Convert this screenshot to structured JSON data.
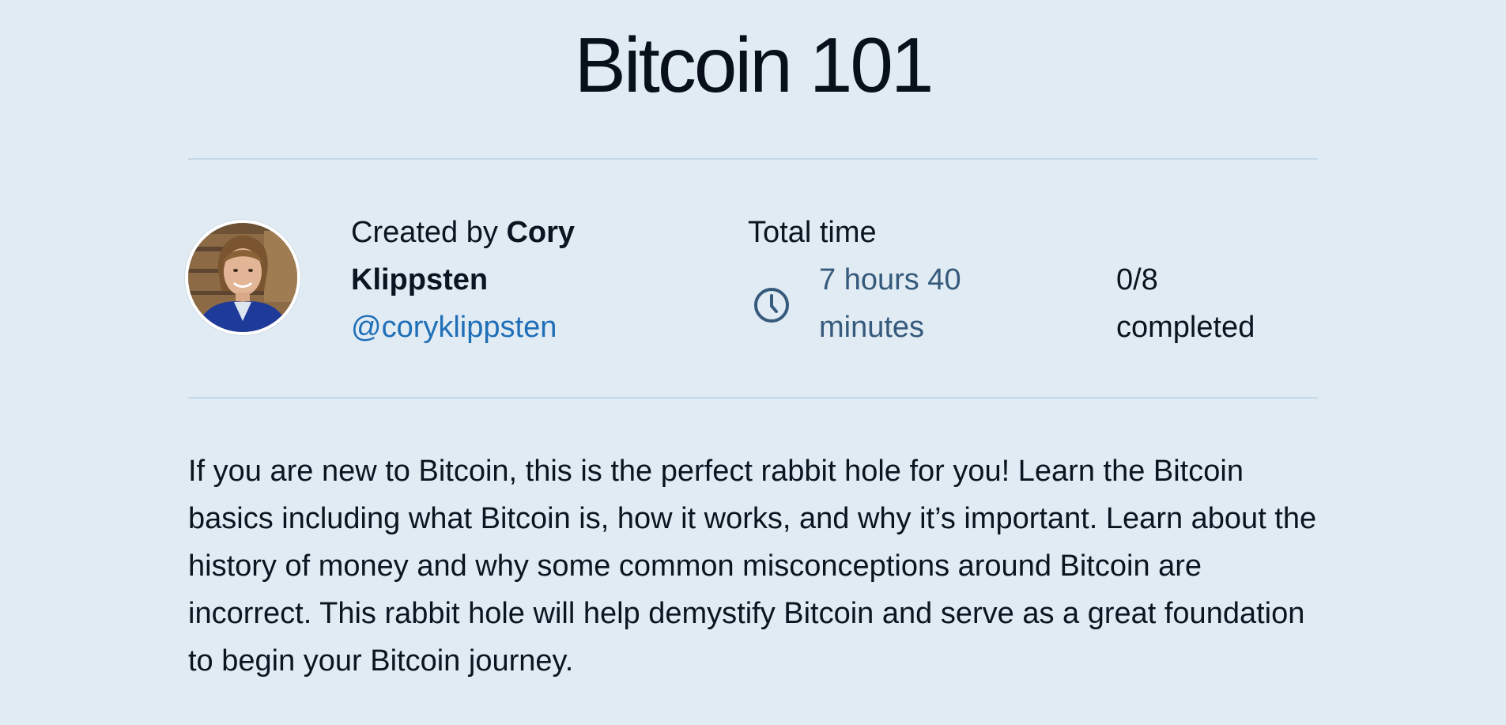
{
  "course": {
    "title": "Bitcoin 101"
  },
  "creator": {
    "prefix": "Created by",
    "first_name": "Cory",
    "last_name": "Klippsten",
    "handle": "@coryklippsten",
    "avatar_icon": "person-photo"
  },
  "time": {
    "label": "Total time",
    "value_line1": "7 hours 40",
    "value_line2": "minutes",
    "icon": "clock-icon"
  },
  "progress": {
    "count": "0/8",
    "label": "completed",
    "completed_fraction": 0
  },
  "description": "If you are new to Bitcoin, this is the perfect rabbit hole for you! Learn the Bitcoin basics including what Bitcoin is, how it works, and why it’s important. Learn about the history of money and why some common misconceptions around Bitcoin are incorrect. This rabbit hole will help demystify Bitcoin and serve as a great foundation to begin your Bitcoin journey.",
  "colors": {
    "background": "#e1ebf3",
    "accent_link": "#1f6fb8",
    "time_text": "#365a7c",
    "divider": "#c4d9e8"
  }
}
